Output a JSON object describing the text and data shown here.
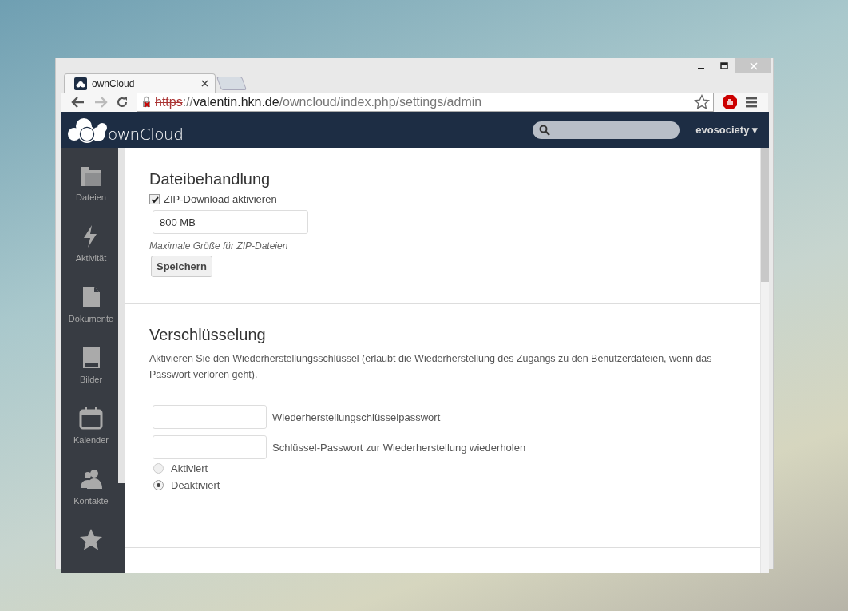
{
  "browser": {
    "tabs": [
      {
        "title": "ownCloud",
        "selected": true
      }
    ],
    "url": {
      "scheme": "https",
      "separator": "://",
      "host": "valentin.hkn.de",
      "path": "/owncloud/index.php/settings/admin"
    },
    "insecure": true
  },
  "header": {
    "logo": "ownCloud",
    "user": "evosociety ▾"
  },
  "sidebar": {
    "items": [
      {
        "label": "Dateien",
        "kind": "folder"
      },
      {
        "label": "Aktivität",
        "kind": "bolt"
      },
      {
        "label": "Dokumente",
        "kind": "document"
      },
      {
        "label": "Bilder",
        "kind": "picture"
      },
      {
        "label": "Kalender",
        "kind": "calendar"
      },
      {
        "label": "Kontakte",
        "kind": "contacts"
      },
      {
        "kind": "star"
      }
    ]
  },
  "sections": [
    {
      "title": "Dateibehandlung",
      "checkbox": {
        "label": "ZIP-Download aktivieren",
        "checked": true
      },
      "size_field": {
        "value": "800 MB"
      },
      "hint": "Maximale Größe für ZIP-Dateien",
      "button": "Speichern"
    },
    {
      "title": "Verschlüsselung",
      "description": "Aktivieren Sie den Wiederherstellungsschlüssel (erlaubt die Wiederherstellung des Zugangs zu den Benutzerdateien, wenn das Passwort verloren geht).",
      "fields": [
        {
          "label": "Wiederherstellungschlüsselpasswort"
        },
        {
          "label": "Schlüssel-Passwort zur Wiederherstellung wiederholen"
        }
      ],
      "radios": [
        {
          "label": "Aktiviert",
          "selected": false,
          "disabled": true
        },
        {
          "label": "Deaktiviert",
          "selected": true,
          "disabled": false
        }
      ]
    }
  ]
}
